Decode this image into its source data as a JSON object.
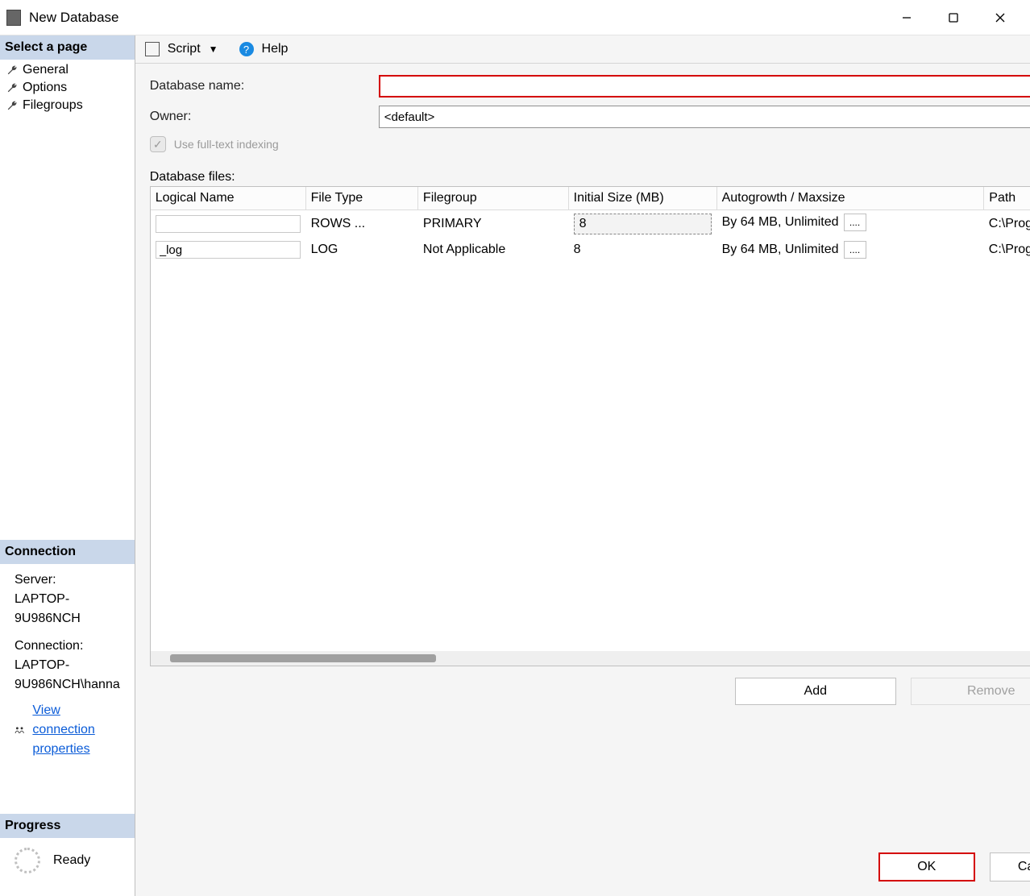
{
  "window": {
    "title": "New Database"
  },
  "sidebar": {
    "header": "Select a page",
    "items": [
      {
        "label": "General"
      },
      {
        "label": "Options"
      },
      {
        "label": "Filegroups"
      }
    ]
  },
  "connection": {
    "header": "Connection",
    "server_label": "Server:",
    "server": "LAPTOP-9U986NCH",
    "connection_label": "Connection:",
    "connection": "LAPTOP-9U986NCH\\hanna",
    "view_props": "View connection properties"
  },
  "progress": {
    "header": "Progress",
    "status": "Ready"
  },
  "toolbar": {
    "script": "Script",
    "help": "Help"
  },
  "form": {
    "dbname_label": "Database name:",
    "dbname_value": "",
    "owner_label": "Owner:",
    "owner_value": "<default>",
    "fulltext_label": "Use full-text indexing",
    "dbfiles_label": "Database files:"
  },
  "grid": {
    "headers": {
      "logical_name": "Logical Name",
      "file_type": "File Type",
      "filegroup": "Filegroup",
      "initial_size": "Initial Size (MB)",
      "autogrowth": "Autogrowth / Maxsize",
      "path": "Path"
    },
    "rows": [
      {
        "logical_name": "",
        "file_type": "ROWS ...",
        "filegroup": "PRIMARY",
        "initial_size": "8",
        "autogrowth": "By 64 MB, Unlimited",
        "path": "C:\\Progra"
      },
      {
        "logical_name": "_log",
        "file_type": "LOG",
        "filegroup": "Not Applicable",
        "initial_size": "8",
        "autogrowth": "By 64 MB, Unlimited",
        "path": "C:\\Progra"
      }
    ],
    "ellipsis": "...."
  },
  "buttons": {
    "add": "Add",
    "remove": "Remove",
    "ok": "OK",
    "cancel": "Cancel",
    "ellipsis": "..."
  },
  "checkmark": "✓"
}
